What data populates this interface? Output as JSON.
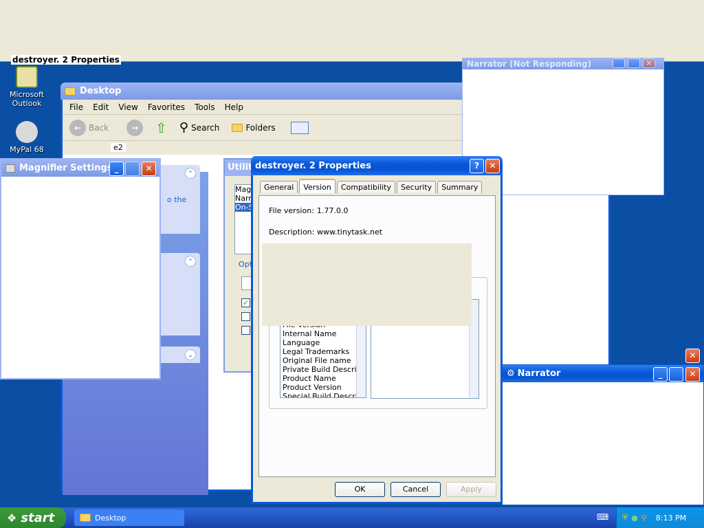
{
  "top_strip": {
    "ghost_title": "destroyer. 2 Properties"
  },
  "desktop_icons": [
    {
      "label": "Microsoft Outlook"
    },
    {
      "label": "MyPal 68"
    }
  ],
  "explorer": {
    "title": "Desktop",
    "menu": [
      "File",
      "Edit",
      "View",
      "Favorites",
      "Tools",
      "Help"
    ],
    "toolbar": {
      "back": "Back",
      "search": "Search",
      "folders": "Folders"
    },
    "address_value": "e2",
    "task_text": "o the"
  },
  "utility": {
    "title": "Utility",
    "items": [
      "Mag",
      "Narr",
      "On-S"
    ],
    "options_label": "Opt"
  },
  "narrator_nr": {
    "title": "Narrator (Not Responding)"
  },
  "magnifier": {
    "title": "Magnifier Settings"
  },
  "narrator": {
    "title": "Narrator"
  },
  "props": {
    "title": "destroyer. 2 Properties",
    "tabs": [
      "General",
      "Version",
      "Compatibility",
      "Security",
      "Summary"
    ],
    "file_version_label": "File version:",
    "file_version": "1.77.0.0",
    "description_label": "Description:",
    "description": "www.tinytask.net",
    "list_items": [
      "File Version",
      "Internal Name",
      "Language",
      "Legal Trademarks",
      "Original File name",
      "Private Build Descripti",
      "Product Name",
      "Product Version",
      "Special Build Descript"
    ],
    "ok": "OK",
    "cancel": "Cancel",
    "apply": "Apply"
  },
  "taskbar": {
    "start": "start",
    "task": "Desktop",
    "clock": "8:13 PM"
  }
}
